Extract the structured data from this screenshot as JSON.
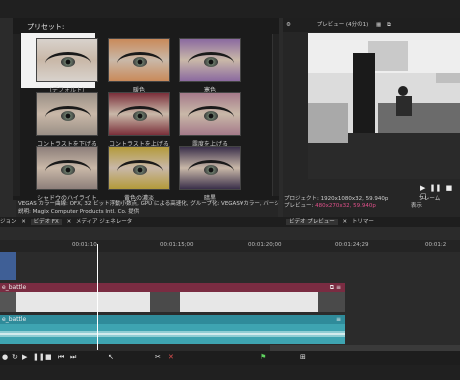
{
  "fx_panel": {
    "presets_label": "プリセット:",
    "presets": [
      {
        "label": "(デフォルト)",
        "tint": "#d8d2cc"
      },
      {
        "label": "暖色",
        "tint": "#c98a5a"
      },
      {
        "label": "寒色",
        "tint": "#8b6aa0"
      },
      {
        "label": "コントラストを下げる",
        "tint": "#9a8f86"
      },
      {
        "label": "コントラストを上げる",
        "tint": "#7a2f3a"
      },
      {
        "label": "露度を上げる",
        "tint": "#a57a8a"
      },
      {
        "label": "シャドウのハイライト",
        "tint": "#8d7f7a"
      },
      {
        "label": "黄色の濃淡",
        "tint": "#b39a3a"
      },
      {
        "label": "暗黒",
        "tint": "#3a2f4a"
      }
    ],
    "description_line1": "VEGAS カラー曲線: OFX, 32 ビット浮動小数点, GPU による高速化, グループ化: VEGAS¥カラー, バージョン",
    "description_line2": "説明: Magix Computer Products Intl. Co. 提供"
  },
  "left_tabs": [
    "ジョン",
    "ビデオ FX",
    "メディア ジェネレータ"
  ],
  "preview": {
    "toolbar_label": "プレビュー (4分の1)",
    "project_label": "プロジェクト:",
    "project_value": "1920x1080x32, 59.940p",
    "preview_label": "プレビュー:",
    "preview_value": "480x270x32, 59.940p",
    "frame_label": "フレーム",
    "display_label": "表示",
    "tabs": [
      "ビデオ プレビュー",
      "トリマー"
    ]
  },
  "timeline": {
    "ruler_times": [
      "00:01:10",
      "00:01:15;00",
      "00:01:20;00",
      "00:01:24;29",
      "00:01:2"
    ],
    "track_a_name": "e_battle",
    "track_b_name": "e_battle"
  },
  "colors": {
    "preview_value_color": "#e0508a",
    "accent_blue": "#3f5f96"
  }
}
